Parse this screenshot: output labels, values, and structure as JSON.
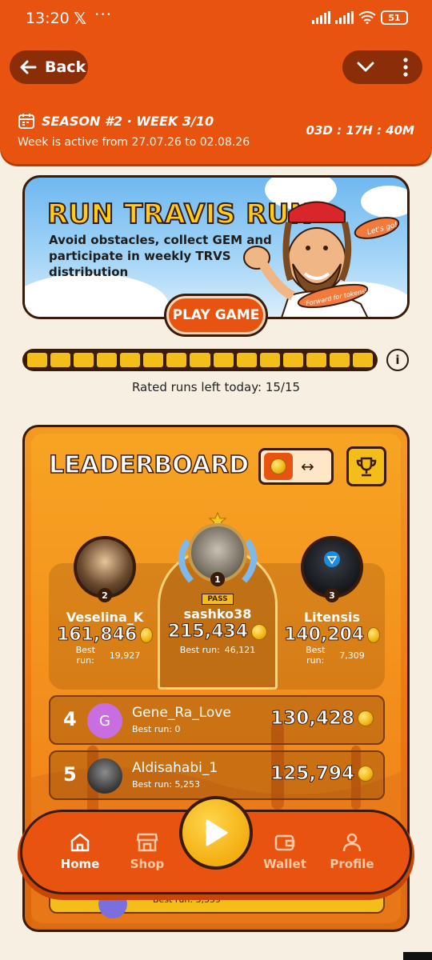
{
  "status_bar": {
    "time": "13:20",
    "x_label": "𝕏",
    "dots": "···",
    "battery": "51"
  },
  "header": {
    "back_label": "Back",
    "season_label": "SEASON #2 · WEEK 3/10",
    "week_active": "Week is active from 27.07.26 to 02.08.26",
    "countdown": "03D : 17H : 40M"
  },
  "banner": {
    "title": "RUN TRAVIS RUN",
    "description": "Avoid obstacles, collect GEM and participate in weekly TRVS distribution",
    "speech_1": "Let's go!",
    "speech_2": "Forward for tokens!",
    "play_label": "PLAY GAME"
  },
  "progress": {
    "segments": 15,
    "filled": 15
  },
  "runs_left": "Rated runs left today: 15/15",
  "leaderboard": {
    "title": "LEADERBOARD",
    "toggle_arrow": "↔",
    "podium": [
      {
        "rank": "2",
        "name": "Veselina_K",
        "score": "161,846",
        "best_label": "Best run:",
        "best": "19,927"
      },
      {
        "rank": "1",
        "name": "sashko38",
        "score": "215,434",
        "best_label": "Best run:",
        "best": "46,121",
        "badge": "PASS"
      },
      {
        "rank": "3",
        "name": "Litensis",
        "score": "140,204",
        "best_label": "Best run:",
        "best": "7,309"
      }
    ],
    "rows": [
      {
        "rank": "4",
        "initial": "G",
        "name": "Gene_Ra_Love",
        "best": "Best run:  0",
        "score": "130,428"
      },
      {
        "rank": "5",
        "initial": "",
        "name": "Aldisahabi_1",
        "best": "Best run:  5,253",
        "score": "125,794"
      }
    ],
    "partial_best": "Best run:  3,359"
  },
  "nav": {
    "home": "Home",
    "shop": "Shop",
    "wallet": "Wallet",
    "profile": "Profile"
  },
  "colors": {
    "primary": "#e8530f",
    "dark": "#3a1a08",
    "gold": "#f3be1a"
  }
}
